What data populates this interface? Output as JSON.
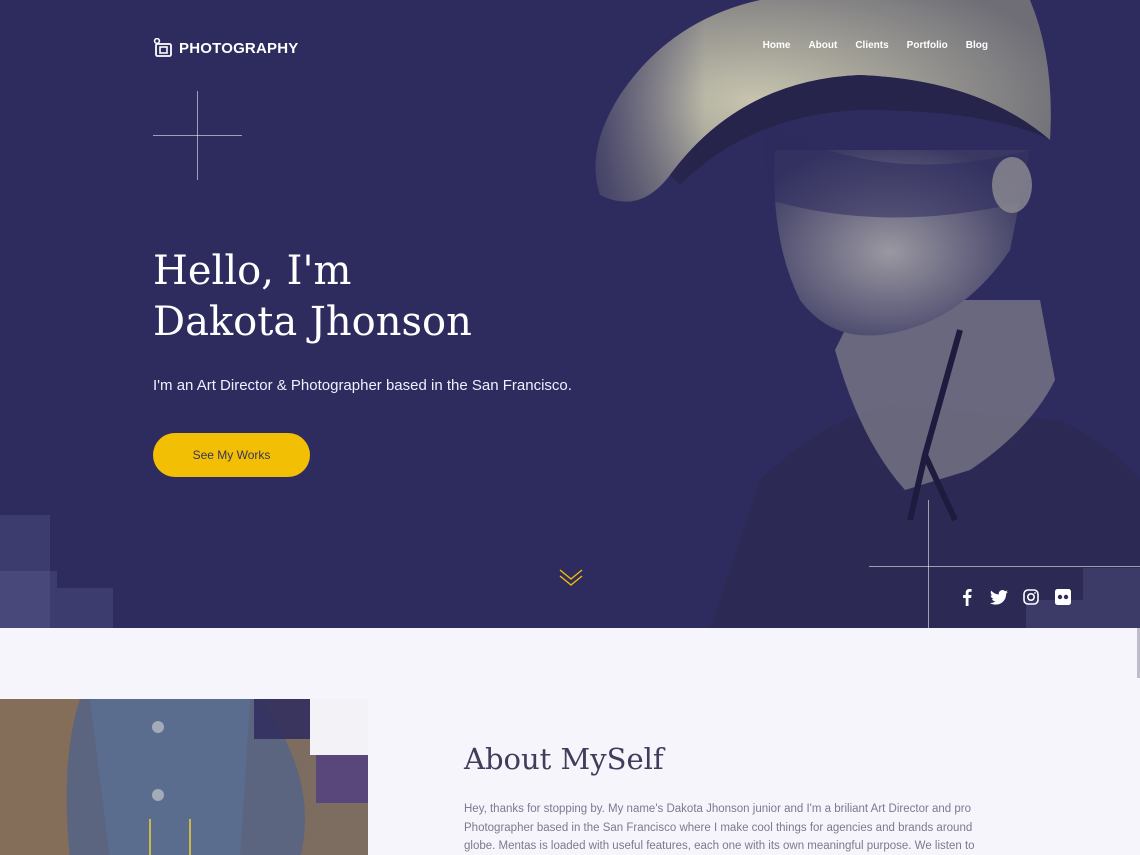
{
  "brand": {
    "name": "PHOTOGRAPHY",
    "icon": "camera-icon"
  },
  "nav": {
    "items": [
      "Home",
      "About",
      "Clients",
      "Portfolio",
      "Blog"
    ]
  },
  "hero": {
    "title_line1": "Hello, I'm",
    "title_line2": "Dakota Jhonson",
    "subtitle": "I'm an Art Director & Photographer based in the San Francisco.",
    "cta_label": "See My Works"
  },
  "social": [
    "facebook-icon",
    "twitter-icon",
    "instagram-icon",
    "flickr-icon"
  ],
  "about": {
    "title": "About MySelf",
    "text": "Hey, thanks for stopping by. My name's Dakota Jhonson junior and I'm a briliant Art Director and pro Photographer based in the San Francisco where I make cool things for agencies and brands around globe. Mentas is loaded with useful features, each one with its own meaningful purpose. We listen to"
  },
  "colors": {
    "hero_bg": "#2e2c5e",
    "accent": "#f2bf05",
    "page_bg": "#f6f5fb",
    "heading": "#3f3d5a",
    "body_text": "#7b7a90"
  }
}
